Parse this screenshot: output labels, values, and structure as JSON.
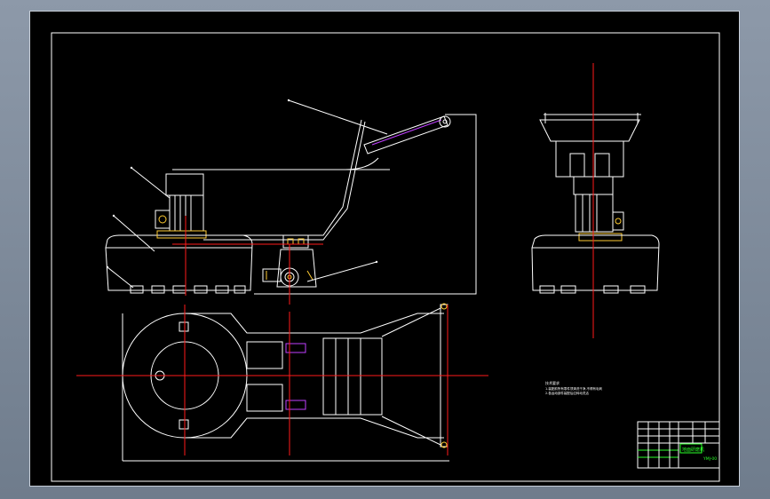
{
  "drawing": {
    "colors": {
      "background": "#000000",
      "outline": "#ffffff",
      "centerline": "#ff1a1a",
      "hidden_parts": "#c040ff",
      "fasteners": "#ffcc33",
      "title_block_text": "#2aff2a",
      "window_frame": "#8d99a9"
    },
    "views": [
      "front-view",
      "side-view",
      "top-view"
    ],
    "notes": {
      "heading": "技术要求",
      "line1": "1.装配前所有零件须清洗干净,不得有毛刺",
      "line2": "2.各运动部件装配后应转动灵活"
    },
    "title_block": {
      "drawing_title": "地面研磨机",
      "code": "YMJ-00"
    }
  }
}
